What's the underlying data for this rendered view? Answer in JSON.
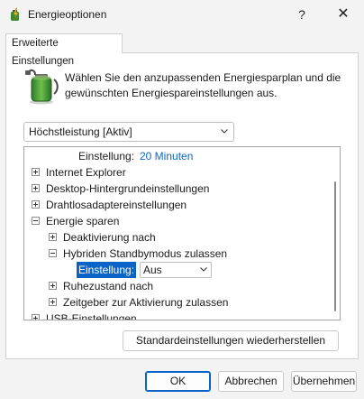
{
  "window": {
    "title": "Energieoptionen",
    "help_glyph": "?",
    "close_glyph": "✕"
  },
  "tab": {
    "label": "Erweiterte Einstellungen"
  },
  "header": {
    "icon": "battery-power-icon",
    "description": "Wählen Sie den anzupassenden Energiesparplan und die gewünschten Energiespareinstellungen aus."
  },
  "plan_select": {
    "value": "Höchstleistung [Aktiv]"
  },
  "tree": {
    "rows": [
      {
        "label": "Einstellung:",
        "value": "20 Minuten"
      },
      {
        "label": "Internet Explorer",
        "state": "collapsed"
      },
      {
        "label": "Desktop-Hintergrundeinstellungen",
        "state": "collapsed"
      },
      {
        "label": "Drahtlosadaptereinstellungen",
        "state": "collapsed"
      },
      {
        "label": "Energie sparen",
        "state": "expanded"
      },
      {
        "label": "Deaktivierung nach",
        "state": "collapsed"
      },
      {
        "label": "Hybriden Standbymodus zulassen",
        "state": "expanded"
      },
      {
        "label": "Einstellung:",
        "value": "Aus",
        "selected": true
      },
      {
        "label": "Ruhezustand nach",
        "state": "collapsed"
      },
      {
        "label": "Zeitgeber zur Aktivierung zulassen",
        "state": "collapsed"
      },
      {
        "label": "USB-Einstellungen",
        "state": "collapsed"
      }
    ]
  },
  "buttons": {
    "restore": "Standardeinstellungen wiederherstellen",
    "ok": "OK",
    "cancel": "Abbrechen",
    "apply": "Übernehmen"
  },
  "colors": {
    "accent": "#0a64c8",
    "link": "#0b66c2"
  }
}
